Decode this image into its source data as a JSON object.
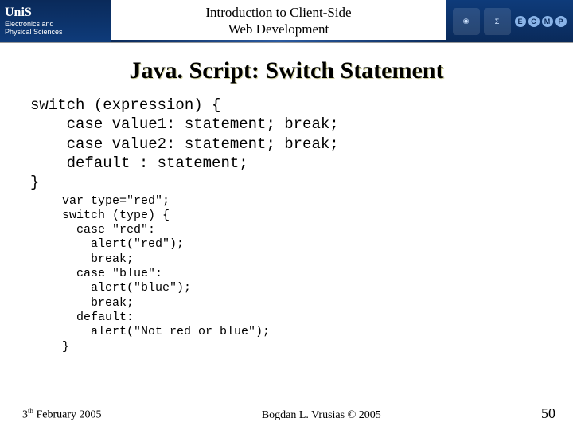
{
  "header": {
    "logo_text": "UniS",
    "dept_line": "Electronics and\nPhysical Sciences",
    "center_title": "Introduction to Client-Side\nWeb Development",
    "mini_labels": [
      "E",
      "C",
      "M",
      "P"
    ]
  },
  "slide": {
    "title": "Java. Script: Switch Statement",
    "syntax": "switch (expression) {\n    case value1: statement; break;\n    case value2: statement; break;\n    default : statement;\n}",
    "example": "var type=\"red\";\nswitch (type) {\n  case \"red\":\n    alert(\"red\");\n    break;\n  case \"blue\":\n    alert(\"blue\");\n    break;\n  default:\n    alert(\"Not red or blue\");\n}"
  },
  "footer": {
    "date_html": "3<sup>th</sup> February 2005",
    "author": "Bogdan L. Vrusias © 2005",
    "page": "50"
  }
}
